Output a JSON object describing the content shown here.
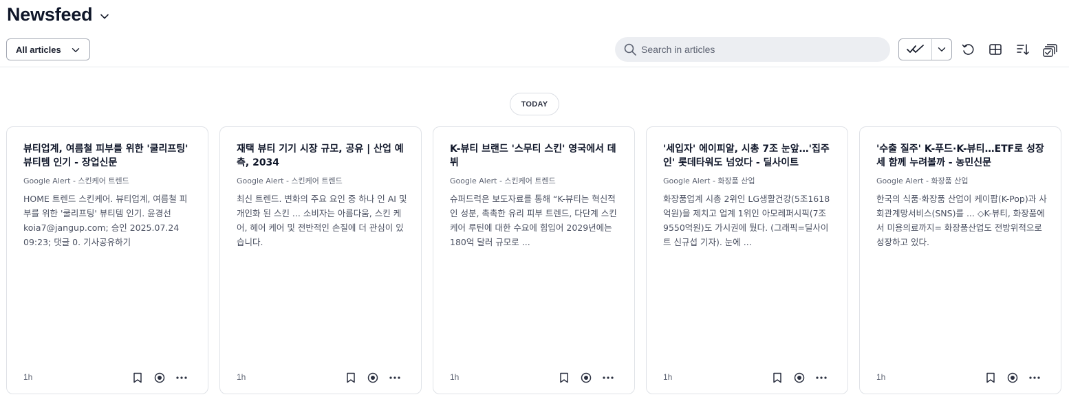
{
  "header": {
    "title": "Newsfeed",
    "filter_label": "All articles",
    "search_placeholder": "Search in articles"
  },
  "toolbar": {
    "icons": [
      "mark-read-icon",
      "chevron-down-icon",
      "refresh-icon",
      "layout-grid-icon",
      "sort-icon",
      "select-multiple-icon"
    ]
  },
  "divider_label": "TODAY",
  "articles": [
    {
      "title": "뷰티업계, 여름철 피부를 위한 '쿨리프팅' 뷰티템 인기 - 장업신문",
      "source": "Google Alert - 스킨케어 트렌드",
      "snippet": "HOME 트렌드 스킨케어. 뷰티업계, 여름철 피부를 위한 '쿨리프팅' 뷰티템 인기. 윤경선 koia7@jangup.com; 승인 2025.07.24 09:23; 댓글 0. 기사공유하기",
      "time": "1h"
    },
    {
      "title": "재택 뷰티 기기 시장 규모, 공유 | 산업 예측, 2034",
      "source": "Google Alert - 스킨케어 트렌드",
      "snippet": "최신 트렌드. 변화의 주요 요인 중 하나 인 AI 및 개인화 된 스킨 ... 소비자는 아름다움, 스킨 케어, 헤어 케어 및 전반적인 손질에 더 관심이 있습니다.",
      "time": "1h"
    },
    {
      "title": "K-뷰티 브랜드 '스무티 스킨' 영국에서 데뷔",
      "source": "Google Alert - 스킨케어 트렌드",
      "snippet": "슈퍼드럭은 보도자료를 통해 “K-뷰티는 혁신적인 성분, 촉촉한 유리 피부 트렌드, 다단계 스킨케어 루틴에 대한 수요에 힘입어 2029년에는 180억 달러 규모로 ...",
      "time": "1h"
    },
    {
      "title": "'세입자' 에이피알, 시총 7조 눈앞…'집주인' 롯데타워도 넘었다 - 딜사이트",
      "source": "Google Alert - 화장품 산업",
      "snippet": "화장품업계 시총 2위인 LG생활건강(5조1618억원)을 제치고 업계 1위인 아모레퍼시픽(7조9550억원)도 가시권에 뒀다. (그래픽=딜사이트 신규섭 기자). 눈에 ...",
      "time": "1h"
    },
    {
      "title": "'수출 질주' K-푸드·K-뷰티…ETF로 성장세 함께 누려볼까 - 농민신문",
      "source": "Google Alert - 화장품 산업",
      "snippet": "한국의 식품·화장품 산업이 케이팝(K-Pop)과 사회관계망서비스(SNS)를 ... ◇K-뷰티, 화장품에서 미용의료까지= 화장품산업도 전방위적으로 성장하고 있다.",
      "time": "1h"
    }
  ]
}
